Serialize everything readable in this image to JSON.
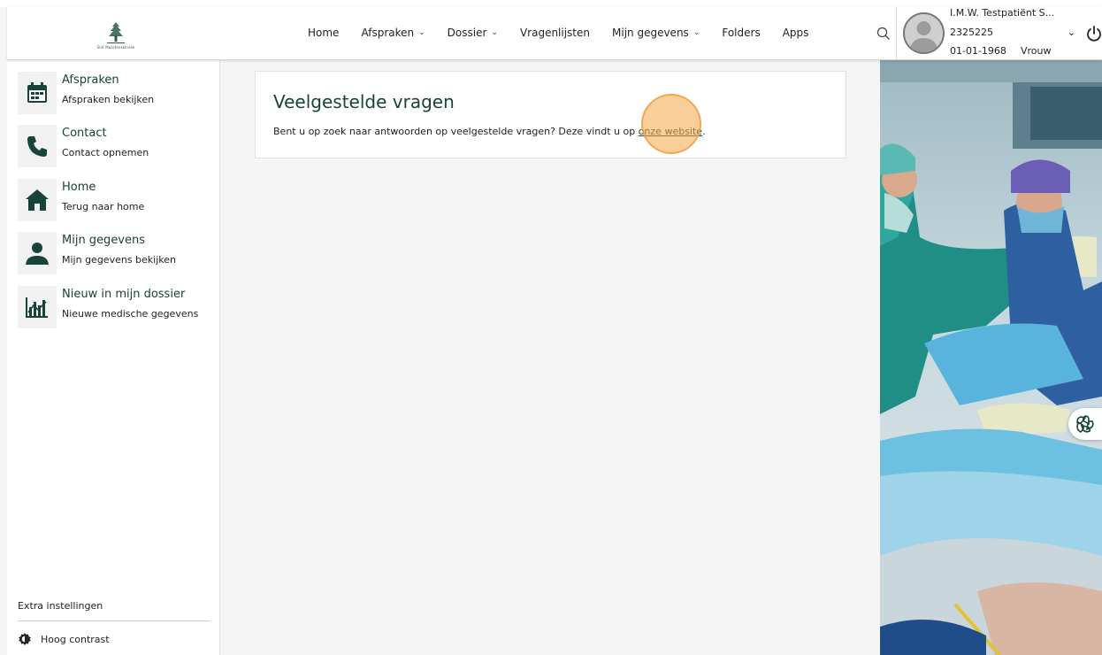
{
  "header": {
    "logo_text": "Sint Maartenskliniek",
    "nav": [
      {
        "label": "Home",
        "has_dropdown": false
      },
      {
        "label": "Afspraken",
        "has_dropdown": true
      },
      {
        "label": "Dossier",
        "has_dropdown": true
      },
      {
        "label": "Vragenlijsten",
        "has_dropdown": false
      },
      {
        "label": "Mijn gegevens",
        "has_dropdown": true
      },
      {
        "label": "Folders",
        "has_dropdown": false
      },
      {
        "label": "Apps",
        "has_dropdown": false
      }
    ],
    "search_icon": "search-icon",
    "user": {
      "name": "I.M.W. Testpatiënt S...",
      "patient_number": "2325225",
      "birth_date": "01-01-1968",
      "gender": "Vrouw"
    },
    "power_icon": "power-icon"
  },
  "sidebar": {
    "items": [
      {
        "title": "Afspraken",
        "subtitle": "Afspraken bekijken",
        "icon": "calendar-icon"
      },
      {
        "title": "Contact",
        "subtitle": "Contact opnemen",
        "icon": "phone-icon"
      },
      {
        "title": "Home",
        "subtitle": "Terug naar home",
        "icon": "home-icon"
      },
      {
        "title": "Mijn gegevens",
        "subtitle": "Mijn gegevens bekijken",
        "icon": "person-icon"
      },
      {
        "title": "Nieuw in mijn dossier",
        "subtitle": "Nieuwe medische gegevens",
        "icon": "chart-icon"
      }
    ],
    "extra_label": "Extra instellingen",
    "contrast_label": "Hoog contrast"
  },
  "main": {
    "title": "Veelgestelde vragen",
    "text_before": "Bent u op zoek naar antwoorden op veelgestelde vragen? Deze vindt u op ",
    "link_text": "onze website",
    "text_after": "."
  },
  "colors": {
    "brand_green": "#17433a",
    "highlight": "#f5a646"
  }
}
